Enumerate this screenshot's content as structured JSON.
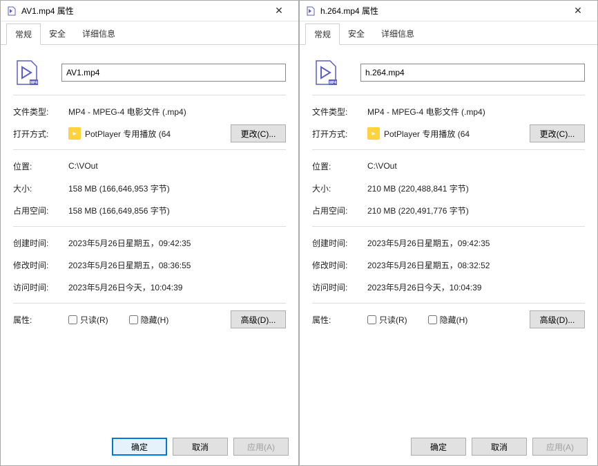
{
  "windows": [
    {
      "title": "AV1.mp4 属性",
      "filename": "AV1.mp4",
      "tabs": {
        "general": "常规",
        "security": "安全",
        "details": "详细信息"
      },
      "labels": {
        "filetype": "文件类型:",
        "openwith": "打开方式:",
        "location": "位置:",
        "size": "大小:",
        "sizeondisk": "占用空间:",
        "created": "创建时间:",
        "modified": "修改时间:",
        "accessed": "访问时间:",
        "attributes": "属性:"
      },
      "values": {
        "filetype": "MP4 - MPEG-4 电影文件 (.mp4)",
        "app": "PotPlayer 专用播放 (64",
        "change_btn": "更改(C)...",
        "location": "C:\\VOut",
        "size": "158 MB (166,646,953 字节)",
        "sizeondisk": "158 MB (166,649,856 字节)",
        "created": "2023年5月26日星期五，09:42:35",
        "modified": "2023年5月26日星期五，08:36:55",
        "accessed": "2023年5月26日今天，10:04:39",
        "readonly": "只读(R)",
        "hidden": "隐藏(H)",
        "advanced": "高级(D)..."
      },
      "buttons": {
        "ok": "确定",
        "cancel": "取消",
        "apply": "应用(A)"
      }
    },
    {
      "title": "h.264.mp4 属性",
      "filename": "h.264.mp4",
      "tabs": {
        "general": "常规",
        "security": "安全",
        "details": "详细信息"
      },
      "labels": {
        "filetype": "文件类型:",
        "openwith": "打开方式:",
        "location": "位置:",
        "size": "大小:",
        "sizeondisk": "占用空间:",
        "created": "创建时间:",
        "modified": "修改时间:",
        "accessed": "访问时间:",
        "attributes": "属性:"
      },
      "values": {
        "filetype": "MP4 - MPEG-4 电影文件 (.mp4)",
        "app": "PotPlayer 专用播放 (64",
        "change_btn": "更改(C)...",
        "location": "C:\\VOut",
        "size": "210 MB (220,488,841 字节)",
        "sizeondisk": "210 MB (220,491,776 字节)",
        "created": "2023年5月26日星期五，09:42:35",
        "modified": "2023年5月26日星期五，08:32:52",
        "accessed": "2023年5月26日今天，10:04:39",
        "readonly": "只读(R)",
        "hidden": "隐藏(H)",
        "advanced": "高级(D)..."
      },
      "buttons": {
        "ok": "确定",
        "cancel": "取消",
        "apply": "应用(A)"
      }
    }
  ]
}
